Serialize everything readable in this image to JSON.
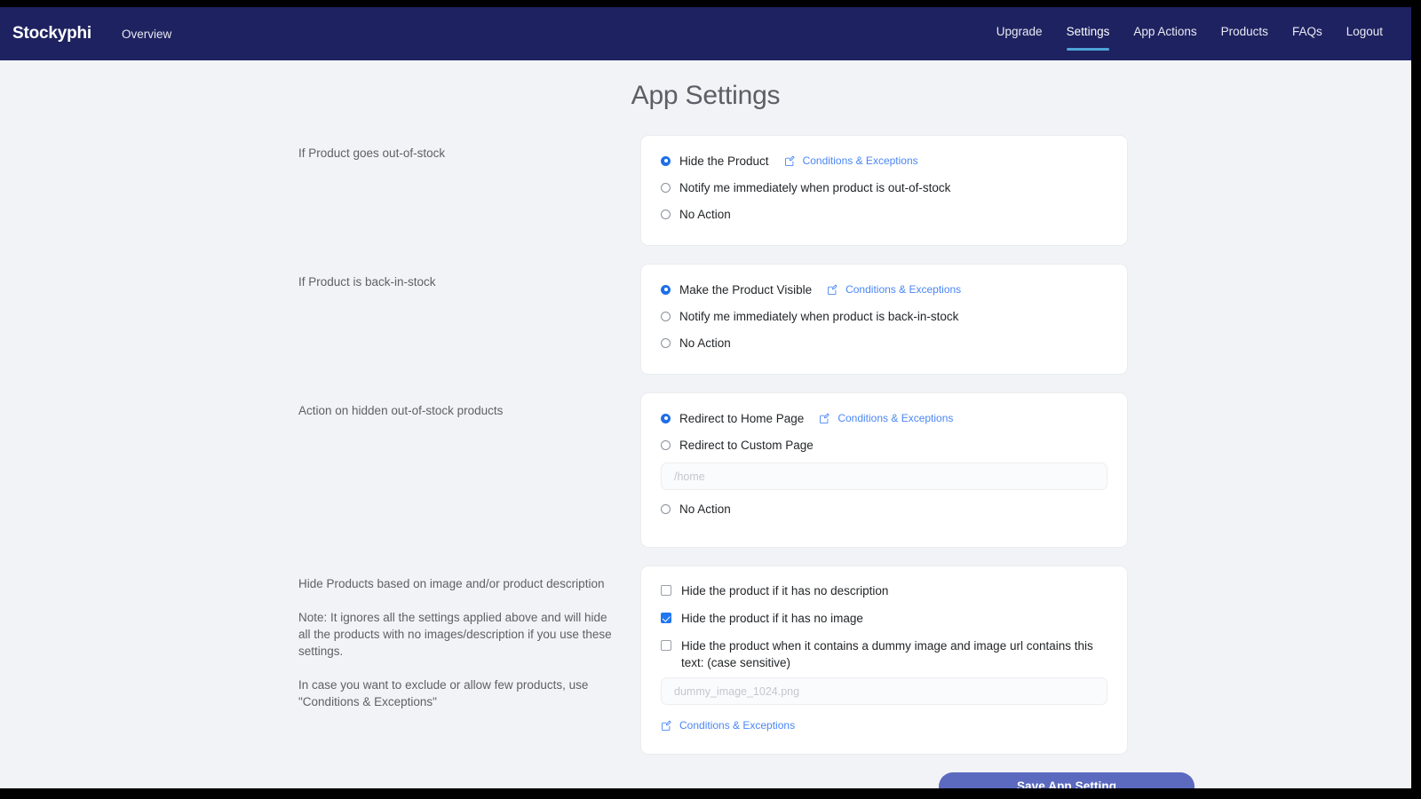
{
  "navbar": {
    "brand": "Stockyphi",
    "overview_label": "Overview",
    "items": [
      {
        "label": "Upgrade",
        "active": false
      },
      {
        "label": "Settings",
        "active": true
      },
      {
        "label": "App Actions",
        "active": false
      },
      {
        "label": "Products",
        "active": false
      },
      {
        "label": "FAQs",
        "active": false
      },
      {
        "label": "Logout",
        "active": false
      }
    ],
    "background_color": "#1e2260",
    "active_underline_color": "#4ea4d8"
  },
  "page": {
    "title": "App Settings",
    "background_color": "#f2f3f6"
  },
  "sections": {
    "out_of_stock": {
      "label": "If Product goes out-of-stock",
      "options": [
        {
          "label": "Hide the Product",
          "selected": true
        },
        {
          "label": "Notify me immediately when product is out-of-stock",
          "selected": false
        },
        {
          "label": "No Action",
          "selected": false
        }
      ],
      "conditions_link": "Conditions & Exceptions"
    },
    "back_in_stock": {
      "label": "If Product is back-in-stock",
      "options": [
        {
          "label": "Make the Product Visible",
          "selected": true
        },
        {
          "label": "Notify me immediately when product is back-in-stock",
          "selected": false
        },
        {
          "label": "No Action",
          "selected": false
        }
      ],
      "conditions_link": "Conditions & Exceptions"
    },
    "hidden_action": {
      "label": "Action on hidden out-of-stock products",
      "options": [
        {
          "label": "Redirect to Home Page",
          "selected": true
        },
        {
          "label": "Redirect to Custom Page",
          "selected": false
        },
        {
          "label": "No Action",
          "selected": false
        }
      ],
      "conditions_link": "Conditions & Exceptions",
      "custom_page_input": {
        "value": "",
        "placeholder": "/home"
      }
    },
    "hide_by_media": {
      "label": "Hide Products based on image and/or product description",
      "note": "Note: It ignores all the settings applied above and will hide all the products with no images/description if you use these settings.",
      "hint": "In case you want to exclude or allow few products, use \"Conditions & Exceptions\"",
      "checkboxes": [
        {
          "label": "Hide the product if it has no description",
          "checked": false
        },
        {
          "label": "Hide the product if it has no image",
          "checked": true
        },
        {
          "label": "Hide the product when it contains a dummy image and image url contains this text: (case sensitive)",
          "checked": false
        }
      ],
      "dummy_image_input": {
        "value": "",
        "placeholder": "dummy_image_1024.png"
      },
      "conditions_link": "Conditions & Exceptions"
    }
  },
  "footer": {
    "save_label": "Save App Setting",
    "save_button_color": "#5b6abf"
  },
  "icons": {
    "pencil_square": "pencil-square-icon"
  }
}
